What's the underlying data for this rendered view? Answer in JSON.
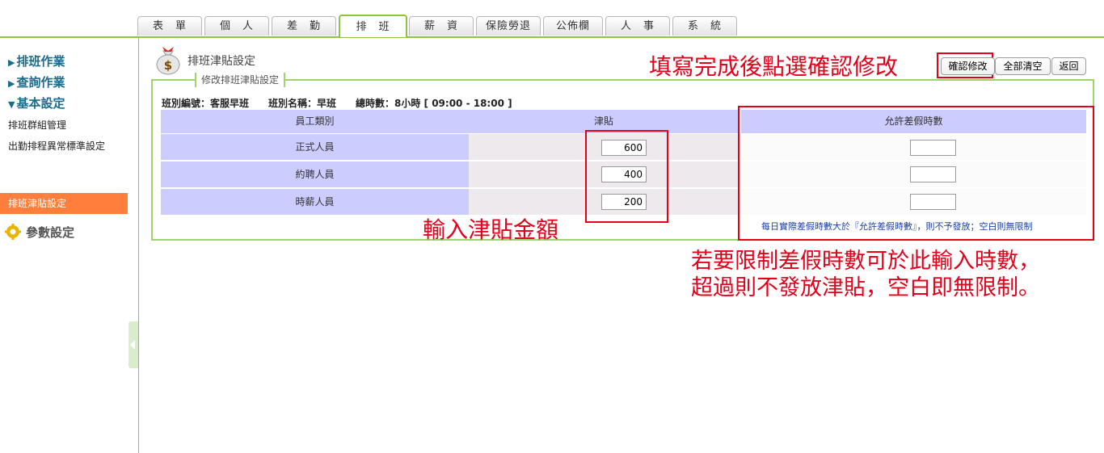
{
  "tabs": [
    {
      "label": "表　單"
    },
    {
      "label": "個　人"
    },
    {
      "label": "差　勤"
    },
    {
      "label": "排　班"
    },
    {
      "label": "薪　資"
    },
    {
      "label": "保險勞退"
    },
    {
      "label": "公佈欄"
    },
    {
      "label": "人　事"
    },
    {
      "label": "系　統"
    }
  ],
  "sidebar": {
    "sections": [
      {
        "label": "排班作業"
      },
      {
        "label": "查詢作業"
      },
      {
        "label": "基本設定"
      }
    ],
    "items": [
      {
        "label": "排班群組管理"
      },
      {
        "label": "出勤排程異常標準設定"
      },
      {
        "label": "排班津貼設定"
      }
    ],
    "param_label": "參數設定"
  },
  "page": {
    "title": "排班津貼設定",
    "legend": "修改排班津貼設定",
    "info": "班別編號：客服早班　　班別名稱：早班　　總時數：8小時 [ 09:00 - 18:00 ]"
  },
  "toolbar": {
    "confirm_label": "確認修改",
    "clear_label": "全部清空",
    "back_label": "返回"
  },
  "table": {
    "headers": [
      "員工類別",
      "津貼",
      "允許差假時數"
    ],
    "rows": [
      {
        "category": "正式人員",
        "allowance": "600",
        "leave_hours": ""
      },
      {
        "category": "約聘人員",
        "allowance": "400",
        "leave_hours": ""
      },
      {
        "category": "時薪人員",
        "allowance": "200",
        "leave_hours": ""
      }
    ],
    "note": "每日實際差假時數大於『允許差假時數』，則不予發放；空白則無限制"
  },
  "annotations": {
    "top": "填寫完成後點選確認修改",
    "middle": "輸入津貼金額",
    "bottom_line1": "若要限制差假時數可於此輸入時數，",
    "bottom_line2": "超過則不發放津貼，空白即無限制。"
  },
  "colors": {
    "accent_green": "#8cc63f",
    "active_orange": "#ff7e3c",
    "header_lavender": "#ccccff",
    "annotation_red": "#e2001a",
    "sidebar_heading": "#1a6c8b"
  },
  "icons": [
    "money-bag-icon",
    "gear-icon",
    "triangle-right-icon",
    "triangle-down-icon",
    "collapse-arrow-icon"
  ]
}
